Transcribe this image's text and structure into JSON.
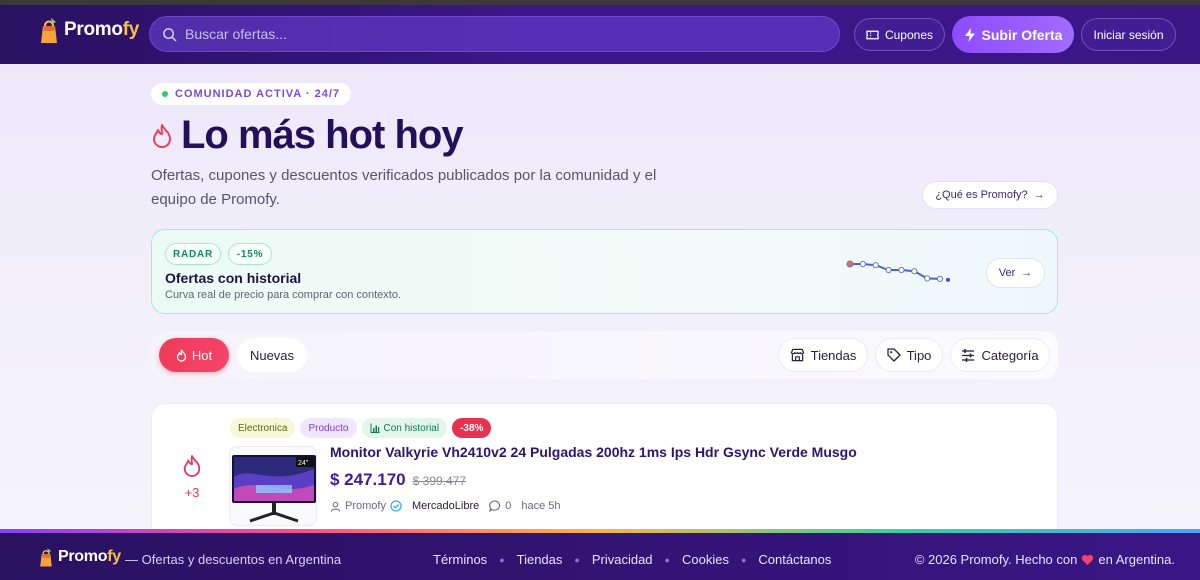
{
  "header": {
    "brand_prefix": "Promo",
    "brand_suffix": "fy",
    "search_placeholder": "Buscar ofertas...",
    "coupons_label": "Cupones",
    "upload_label": "Subir Oferta",
    "login_label": "Iniciar sesión"
  },
  "hero": {
    "badge": "COMUNIDAD ACTIVA · 24/7",
    "title": "Lo más hot hoy",
    "subtitle": "Ofertas, cupones y descuentos verificados publicados por la comunidad y el equipo de Promofy.",
    "about_label": "¿Qué es Promofy?"
  },
  "radar": {
    "tag_radar": "RADAR",
    "tag_drop": "-15%",
    "title": "Ofertas con historial",
    "subtitle": "Curva real de precio para comprar con contexto.",
    "view_label": "Ver",
    "sparkline": [
      0.0,
      0.0,
      0.05,
      0.25,
      0.25,
      0.3,
      0.6,
      0.62
    ]
  },
  "filters": {
    "tab_hot": "Hot",
    "tab_new": "Nuevas",
    "stores": "Tiendas",
    "type": "Tipo",
    "category": "Categoría"
  },
  "deal": {
    "votes": "+3",
    "tags": {
      "category": "Electronica",
      "kind": "Producto",
      "history": "Con historial",
      "discount": "-38%"
    },
    "thumb_label": "24\"",
    "title": "Monitor Valkyrie Vh2410v2 24 Pulgadas 200hz 1ms Ips Hdr Gsync Verde Musgo",
    "price_now": "$ 247.170",
    "price_old": "$ 399.477",
    "author": "Promofy",
    "store": "MercadoLibre",
    "comments": "0",
    "time": "hace 5h"
  },
  "footer": {
    "brand_prefix": "Promo",
    "brand_suffix": "fy",
    "tagline": "— Ofertas y descuentos en Argentina",
    "links": [
      "Términos",
      "Tiendas",
      "Privacidad",
      "Cookies",
      "Contáctanos"
    ],
    "copy_prefix": "© 2026 Promofy. Hecho con",
    "copy_suffix": "en Argentina."
  },
  "colors": {
    "header_bg": "#3b1688",
    "accent_purple": "#8d4bff",
    "hot_red": "#ef3b5a",
    "radar_green": "#a9e8d6"
  }
}
